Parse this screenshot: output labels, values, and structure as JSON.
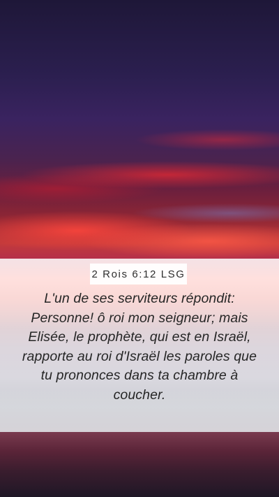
{
  "reference": "2 Rois 6:12 LSG",
  "verse_text": "L'un de ses serviteurs répondit: Personne! ô roi mon seigneur; mais Elisée, le prophète, qui est en Israël, rapporte au roi d'Israël les paroles que tu prononces dans ta chambre à coucher."
}
